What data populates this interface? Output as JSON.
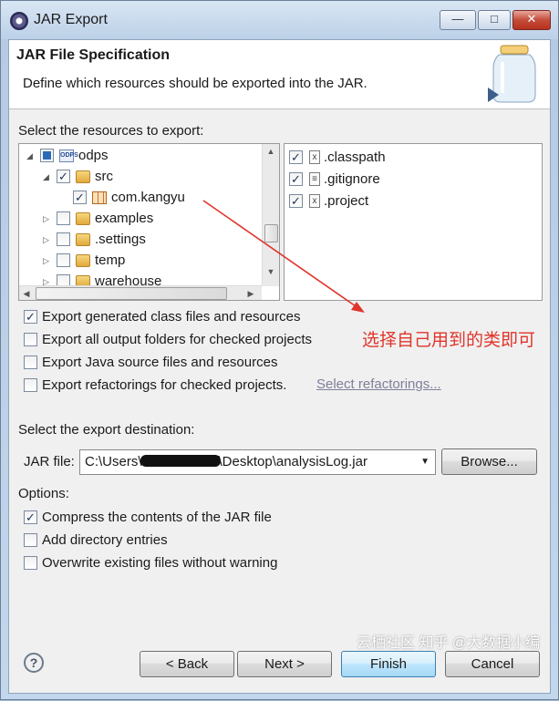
{
  "window": {
    "title": "JAR Export"
  },
  "header": {
    "title": "JAR File Specification",
    "description": "Define which resources should be exported into the JAR."
  },
  "resources_label": "Select the resources to export:",
  "tree": [
    {
      "label": "odps",
      "state": "partial",
      "icon": "project-icon",
      "expanded": true
    },
    {
      "label": "src",
      "state": "checked",
      "icon": "source-folder-icon",
      "expanded": true
    },
    {
      "label": "com.kangyu",
      "state": "checked",
      "icon": "package-icon"
    },
    {
      "label": "examples",
      "state": "unchecked",
      "icon": "source-folder-icon"
    },
    {
      "label": ".settings",
      "state": "unchecked",
      "icon": "folder-icon"
    },
    {
      "label": "temp",
      "state": "unchecked",
      "icon": "folder-icon"
    },
    {
      "label": "warehouse",
      "state": "unchecked",
      "icon": "folder-icon"
    }
  ],
  "files": [
    {
      "label": ".classpath",
      "state": "checked",
      "icon": "xml-file-icon"
    },
    {
      "label": ".gitignore",
      "state": "checked",
      "icon": "text-file-icon"
    },
    {
      "label": ".project",
      "state": "checked",
      "icon": "xml-file-icon"
    }
  ],
  "export_options": [
    {
      "label": "Export generated class files and resources",
      "checked": true
    },
    {
      "label": "Export all output folders for checked projects",
      "checked": false
    },
    {
      "label": "Export Java source files and resources",
      "checked": false
    },
    {
      "label": "Export refactorings for checked projects.",
      "checked": false
    }
  ],
  "refactorings_link": "Select refactorings...",
  "annotation": "选择自己用到的类即可",
  "destination_label": "Select the export destination:",
  "jar_file": {
    "label": "JAR file:",
    "value_prefix": "C:\\Users\\",
    "value_suffix": "\\Desktop\\analysisLog.jar",
    "browse": "Browse..."
  },
  "options_label": "Options:",
  "options": [
    {
      "label": "Compress the contents of the JAR file",
      "checked": true
    },
    {
      "label": "Add directory entries",
      "checked": false
    },
    {
      "label": "Overwrite existing files without warning",
      "checked": false
    }
  ],
  "buttons": {
    "back": "< Back",
    "next": "Next >",
    "finish": "Finish",
    "cancel": "Cancel"
  },
  "watermark": "云栖社区 知乎 @大数据小编",
  "colors": {
    "annotation": "#e0352b",
    "accent": "#3c7fb1"
  }
}
